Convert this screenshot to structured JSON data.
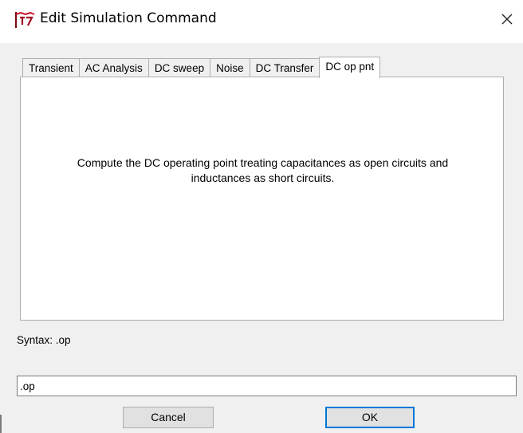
{
  "window": {
    "title": "Edit Simulation Command",
    "app_icon": "ltspice-app-icon",
    "close_icon": "close-icon",
    "close_glyph": "✕"
  },
  "tabs": [
    {
      "label": "Transient",
      "active": false
    },
    {
      "label": "AC Analysis",
      "active": false
    },
    {
      "label": "DC sweep",
      "active": false
    },
    {
      "label": "Noise",
      "active": false
    },
    {
      "label": "DC Transfer",
      "active": false
    },
    {
      "label": "DC op pnt",
      "active": true
    }
  ],
  "panel": {
    "description_line1": "Compute the DC operating point treating capacitances as open circuits and",
    "description_line2": "inductances as short circuits."
  },
  "syntax": {
    "text": "Syntax: .op"
  },
  "command": {
    "value": ".op"
  },
  "buttons": {
    "cancel_label": "Cancel",
    "ok_label": "OK"
  },
  "colors": {
    "accent": "#0078d7",
    "icon_red": "#c8102e"
  }
}
